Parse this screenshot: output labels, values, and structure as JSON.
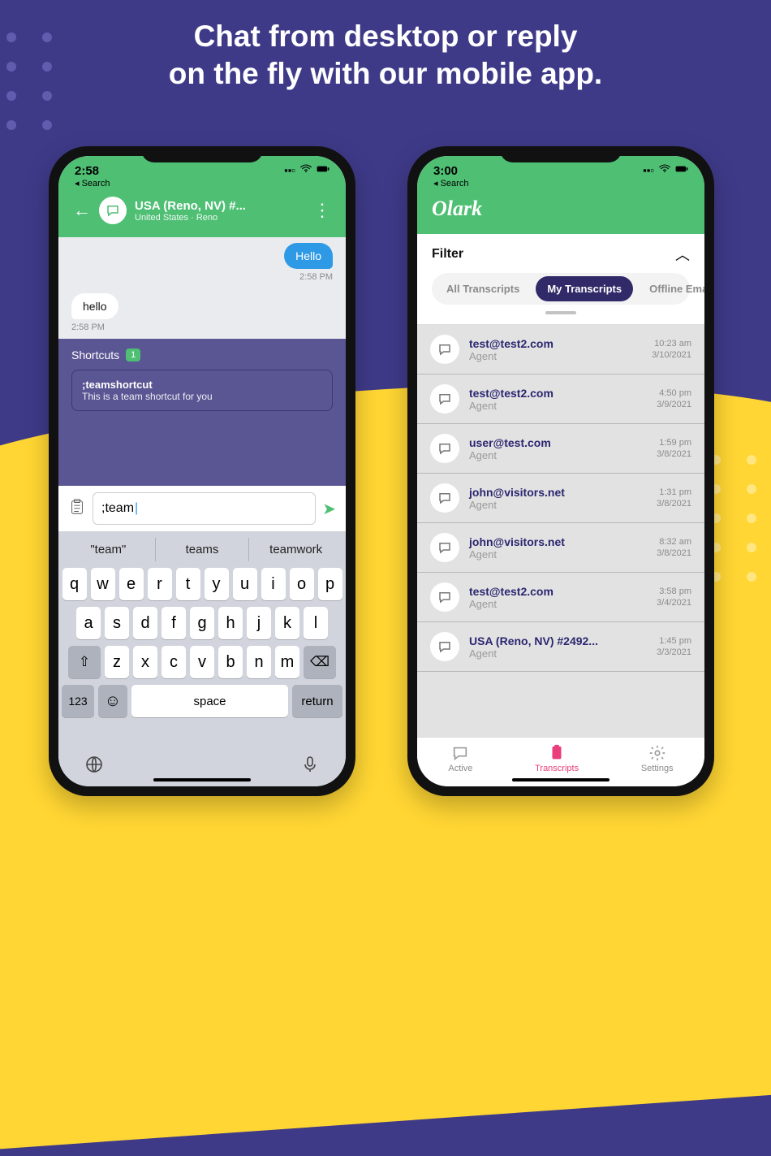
{
  "hero": "Chat from desktop or reply\non the fly with our mobile app.",
  "leftPhone": {
    "status": {
      "time": "2:58",
      "back": "◂ Search"
    },
    "header": {
      "title": "USA (Reno, NV) #...",
      "subtitle": "United States · Reno"
    },
    "messages": {
      "out": "Hello",
      "outTime": "2:58 PM",
      "in": "hello",
      "inTime": "2:58 PM"
    },
    "shortcuts": {
      "label": "Shortcuts",
      "count": "1",
      "item": {
        "cmd": ";teamshortcut",
        "desc": "This is a team shortcut for you"
      }
    },
    "input": ";team",
    "suggestions": [
      "\"team\"",
      "teams",
      "teamwork"
    ],
    "keys_r1": [
      "q",
      "w",
      "e",
      "r",
      "t",
      "y",
      "u",
      "i",
      "o",
      "p"
    ],
    "keys_r2": [
      "a",
      "s",
      "d",
      "f",
      "g",
      "h",
      "j",
      "k",
      "l"
    ],
    "keys_r3": [
      "z",
      "x",
      "c",
      "v",
      "b",
      "n",
      "m"
    ],
    "k123": "123",
    "kspace": "space",
    "kreturn": "return"
  },
  "rightPhone": {
    "status": {
      "time": "3:00",
      "back": "◂ Search"
    },
    "brand": "Olark",
    "filter": {
      "label": "Filter",
      "tabs": [
        "All Transcripts",
        "My Transcripts",
        "Offline Emails"
      ]
    },
    "rows": [
      {
        "email": "test@test2.com",
        "role": "Agent",
        "time": "10:23 am",
        "date": "3/10/2021"
      },
      {
        "email": "test@test2.com",
        "role": "Agent",
        "time": "4:50 pm",
        "date": "3/9/2021"
      },
      {
        "email": "user@test.com",
        "role": "Agent",
        "time": "1:59 pm",
        "date": "3/8/2021"
      },
      {
        "email": "john@visitors.net",
        "role": "Agent",
        "time": "1:31 pm",
        "date": "3/8/2021"
      },
      {
        "email": "john@visitors.net",
        "role": "Agent",
        "time": "8:32 am",
        "date": "3/8/2021"
      },
      {
        "email": "test@test2.com",
        "role": "Agent",
        "time": "3:58 pm",
        "date": "3/4/2021"
      },
      {
        "email": "USA (Reno, NV) #2492...",
        "role": "Agent",
        "time": "1:45 pm",
        "date": "3/3/2021"
      }
    ],
    "nav": [
      "Active",
      "Transcripts",
      "Settings"
    ]
  }
}
